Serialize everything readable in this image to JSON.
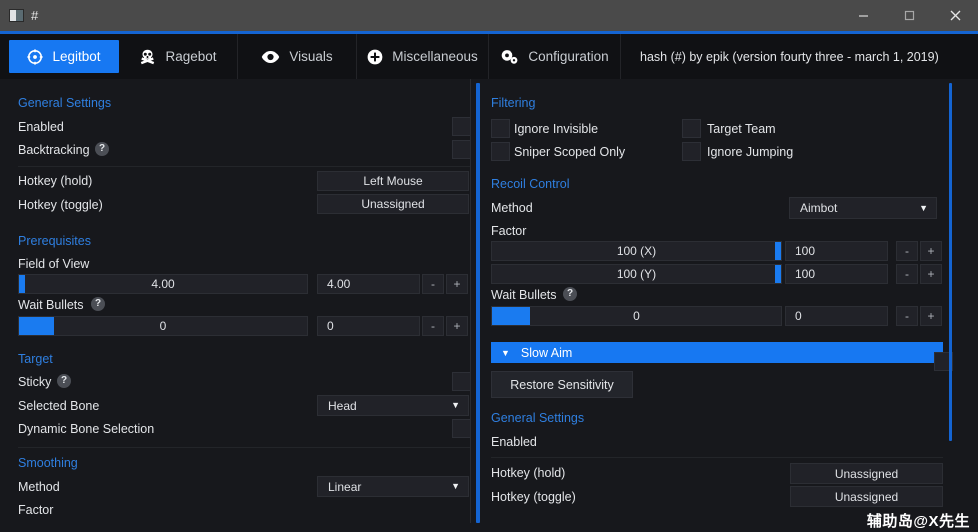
{
  "window": {
    "title": "#",
    "icon": "app-icon",
    "controls": {
      "minimize": "minimize-icon",
      "maximize": "maximize-icon",
      "close": "close-icon"
    }
  },
  "colors": {
    "accent": "#1778f2",
    "accent_line": "#1464d2",
    "section_heading": "#2f7fe0",
    "panel_bg": "#17181c",
    "field_bg": "#212228",
    "titlebar_bg": "#4a4a4a"
  },
  "tabs": [
    {
      "label": "Legitbot",
      "icon": "crosshair-icon",
      "active": true
    },
    {
      "label": "Ragebot",
      "icon": "skull-icon",
      "active": false
    },
    {
      "label": "Visuals",
      "icon": "eye-icon",
      "active": false
    },
    {
      "label": "Miscellaneous",
      "icon": "plus-circle-icon",
      "active": false
    },
    {
      "label": "Configuration",
      "icon": "gears-icon",
      "active": false
    }
  ],
  "header_note": "hash (#) by epik (version fourty three - march 1, 2019)",
  "left_panel": {
    "sections": [
      {
        "heading": "General Settings"
      },
      {
        "heading": "Prerequisites"
      },
      {
        "heading": "Target"
      },
      {
        "heading": "Smoothing"
      }
    ],
    "general": {
      "heading": "General Settings",
      "enabled": {
        "label": "Enabled",
        "checked": false
      },
      "backtracking": {
        "label": "Backtracking",
        "checked": false,
        "help": "?"
      },
      "hotkey_hold": {
        "label": "Hotkey (hold)",
        "value": "Left Mouse"
      },
      "hotkey_toggle": {
        "label": "Hotkey (toggle)",
        "value": "Unassigned"
      }
    },
    "prerequisites": {
      "heading": "Prerequisites",
      "field_of_view": {
        "label": "Field of View",
        "slider_value": "4.00",
        "input_value": "4.00",
        "fill_percent": 2,
        "minus": "-",
        "plus": "+"
      },
      "wait_bullets": {
        "label": "Wait Bullets",
        "help": "?",
        "slider_value": "0",
        "input_value": "0",
        "fill_percent": 12,
        "minus": "-",
        "plus": "+"
      }
    },
    "target": {
      "heading": "Target",
      "sticky": {
        "label": "Sticky",
        "help": "?",
        "checked": false
      },
      "selected_bone": {
        "label": "Selected Bone",
        "value": "Head"
      },
      "dynamic_bone_selection": {
        "label": "Dynamic Bone Selection",
        "checked": false
      }
    },
    "smoothing": {
      "heading": "Smoothing",
      "method": {
        "label": "Method",
        "value": "Linear"
      },
      "factor": {
        "label": "Factor"
      }
    }
  },
  "right_panel": {
    "filtering": {
      "heading": "Filtering",
      "items": [
        {
          "label": "Ignore Invisible",
          "checked": false
        },
        {
          "label": "Target Team",
          "checked": false
        },
        {
          "label": "Sniper Scoped Only",
          "checked": false
        },
        {
          "label": "Ignore Jumping",
          "checked": false
        }
      ]
    },
    "recoil_control": {
      "heading": "Recoil Control",
      "method": {
        "label": "Method",
        "value": "Aimbot"
      },
      "factor": {
        "label": "Factor",
        "rows": [
          {
            "slider_value": "100 (X)",
            "input_value": "100",
            "fill_percent": 97,
            "minus": "-",
            "plus": "+"
          },
          {
            "slider_value": "100 (Y)",
            "input_value": "100",
            "fill_percent": 97,
            "minus": "-",
            "plus": "+"
          }
        ]
      },
      "wait_bullets": {
        "label": "Wait Bullets",
        "help": "?",
        "slider_value": "0",
        "input_value": "0",
        "fill_percent": 13,
        "minus": "-",
        "plus": "+"
      }
    },
    "slow_aim": {
      "heading": "Slow Aim",
      "expanded": true,
      "restore_sensitivity": "Restore Sensitivity",
      "general": {
        "heading": "General Settings",
        "enabled": {
          "label": "Enabled",
          "checked": false
        },
        "hotkey_hold": {
          "label": "Hotkey (hold)",
          "value": "Unassigned"
        },
        "hotkey_toggle": {
          "label": "Hotkey (toggle)",
          "value": "Unassigned"
        }
      }
    }
  },
  "watermark": "辅助岛@X先生"
}
